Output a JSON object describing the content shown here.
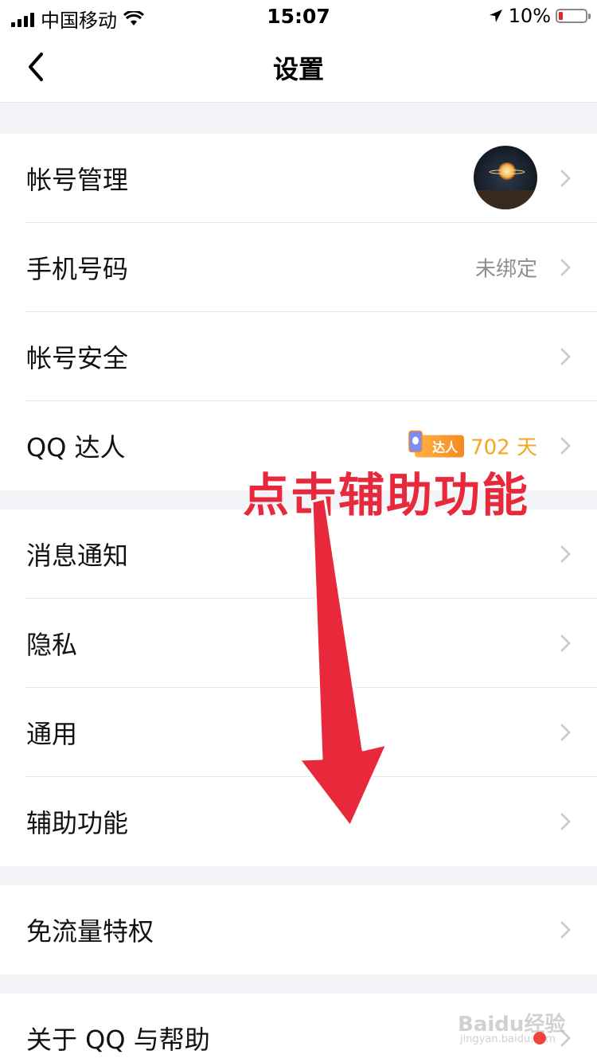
{
  "status_bar": {
    "carrier": "中国移动",
    "time": "15:07",
    "battery": "10%",
    "icons": [
      "signal-icon",
      "wifi-icon",
      "location-icon",
      "battery-icon"
    ]
  },
  "nav": {
    "title": "设置",
    "back_icon": "chevron-left-icon"
  },
  "groups": {
    "account": {
      "account_manage": "帐号管理",
      "phone": "手机号码",
      "phone_value": "未绑定",
      "security": "帐号安全",
      "qq_daren": "QQ 达人",
      "daren_badge": "达人",
      "daren_days": "702 天"
    },
    "settings": {
      "notify": "消息通知",
      "privacy": "隐私",
      "general": "通用",
      "accessibility": "辅助功能"
    },
    "data": {
      "free_data": "免流量特权"
    },
    "about": {
      "about_help": "关于 QQ 与帮助"
    }
  },
  "annotation": {
    "text": "点击辅助功能"
  },
  "watermark": {
    "text": "Baidu经验",
    "sub": "jingyan.baidu.com"
  },
  "colors": {
    "accent_red": "#e8293b",
    "badge_orange": "#f5a623",
    "background": "#f3f4f8"
  }
}
